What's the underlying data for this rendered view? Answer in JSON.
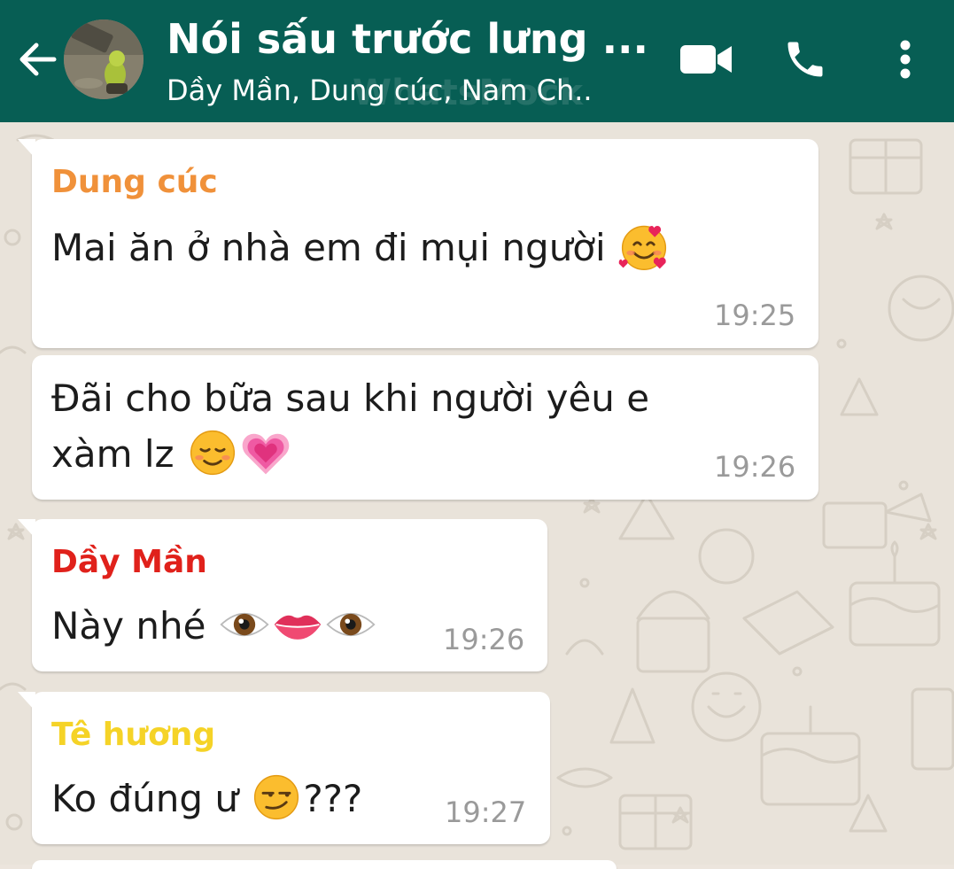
{
  "header": {
    "title": "Nói sấu trước lưng ...",
    "subtitle": "Dầy Mần, Dung cúc, Nam Ch..",
    "watermark": "WhatsMock",
    "colors": {
      "bar": "#075e54",
      "text": "#ffffff"
    },
    "icons": [
      "back-arrow-icon",
      "video-call-icon",
      "phone-icon",
      "more-vertical-icon"
    ]
  },
  "messages": [
    {
      "sender": "Dung cúc",
      "sender_color": "#f0913a",
      "lines": [
        "Mai ăn ở nhà em đi mụi người"
      ],
      "emojis": [
        "smiling-face-with-hearts-emoji"
      ],
      "time": "19:25"
    },
    {
      "sender": "",
      "lines": [
        "Đãi cho bữa sau khi người yêu e",
        "xàm lz"
      ],
      "emojis": [
        "smiling-face-emoji",
        "growing-heart-emoji"
      ],
      "time": "19:26"
    },
    {
      "sender": "Dầy Mần",
      "sender_color": "#e0211b",
      "lines": [
        "Này nhé"
      ],
      "emojis": [
        "eye-emoji",
        "lips-emoji",
        "eye-emoji"
      ],
      "time": "19:26"
    },
    {
      "sender": "Tê hương",
      "sender_color": "#f5d327",
      "lines": [
        "Ko đúng ư",
        "???"
      ],
      "emojis": [
        "smirking-face-emoji"
      ],
      "time": "19:27"
    }
  ]
}
